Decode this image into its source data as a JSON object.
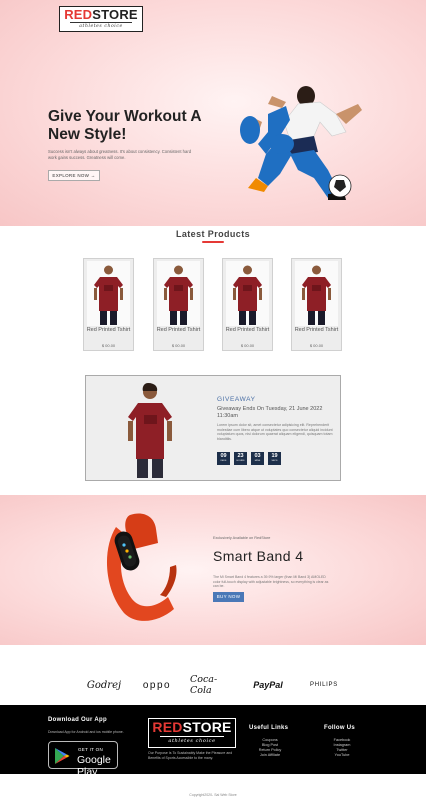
{
  "header": {
    "logo_word_red": "RED",
    "logo_word_dark": "STORE",
    "logo_tagline": "athletes choice"
  },
  "hero": {
    "title": "Give Your Workout A New Style!",
    "subtitle": "Success isn't always about greatness. It's about consistency. Consistent hard work gains success. Greatness will come.",
    "button": "EXPLORE NOW →"
  },
  "latest": {
    "title": "Latest Products",
    "products": [
      {
        "name": "Red Printed Tshirt",
        "price": "$ 00.00"
      },
      {
        "name": "Red Printed Tshirt",
        "price": "$ 00.00"
      },
      {
        "name": "Red Printed Tshirt",
        "price": "$ 00.00"
      },
      {
        "name": "Red Printed Tshirt",
        "price": "$ 00.00"
      }
    ]
  },
  "giveaway": {
    "label": "GIVEAWAY",
    "ends": "Giveaway Ends On Tuesday, 21 June 2022 11:30am",
    "description": "Lorem ipsum dolor sit, amet consectetur adipisicing elit. Reprehenderit molestiae cum libero atque ut voluptates quo consectetur aliquid incidunt voluptatum quos, nisi dolorum quaerat aliquam eligendi, quisquam totam blanditiis.",
    "timer": [
      {
        "value": "09",
        "unit": "DAYS"
      },
      {
        "value": "23",
        "unit": "HOURS"
      },
      {
        "value": "03",
        "unit": "MINS"
      },
      {
        "value": "19",
        "unit": "SECS"
      }
    ]
  },
  "band": {
    "small": "Exclusively Available on RedStore",
    "title": "Smart Band 4",
    "description": "The Mi Smart Band 4 features a 39.9% larger (than Mi Band 3) AMOLED color full-touch display with adjustable brightness, so everything is clear as can be.",
    "button": "BUY NOW"
  },
  "brands": [
    "Godrej",
    "oppo",
    "Coca-Cola",
    "PayPal",
    "PHILIPS"
  ],
  "footer": {
    "download_title": "Download Our App",
    "download_text": "Download App for Android and ios mobile phone.",
    "gplay_small": "GET IT ON",
    "gplay_big": "Google Play",
    "logo_word_red": "RED",
    "logo_word_white": "STORE",
    "logo_tagline": "athletes choice",
    "purpose": "Our Purpose Is To Sustainably Make the Pleasure and Benefits of Sports Accessible to the many.",
    "useful_title": "Useful Links",
    "useful_links": [
      "Coupons",
      "Blog Post",
      "Return Policy",
      "Join Affiliate"
    ],
    "follow_title": "Follow Us",
    "follow_links": [
      "Facebook",
      "Instagram",
      "Twitter",
      "YouTube"
    ]
  },
  "copyright": "Copyright2020- Sai Web Store",
  "colors": {
    "accent": "#e53935",
    "hero_bg": "#fcdada",
    "timer_bg": "#1d2f4a",
    "buy_button": "#4a78b7"
  }
}
